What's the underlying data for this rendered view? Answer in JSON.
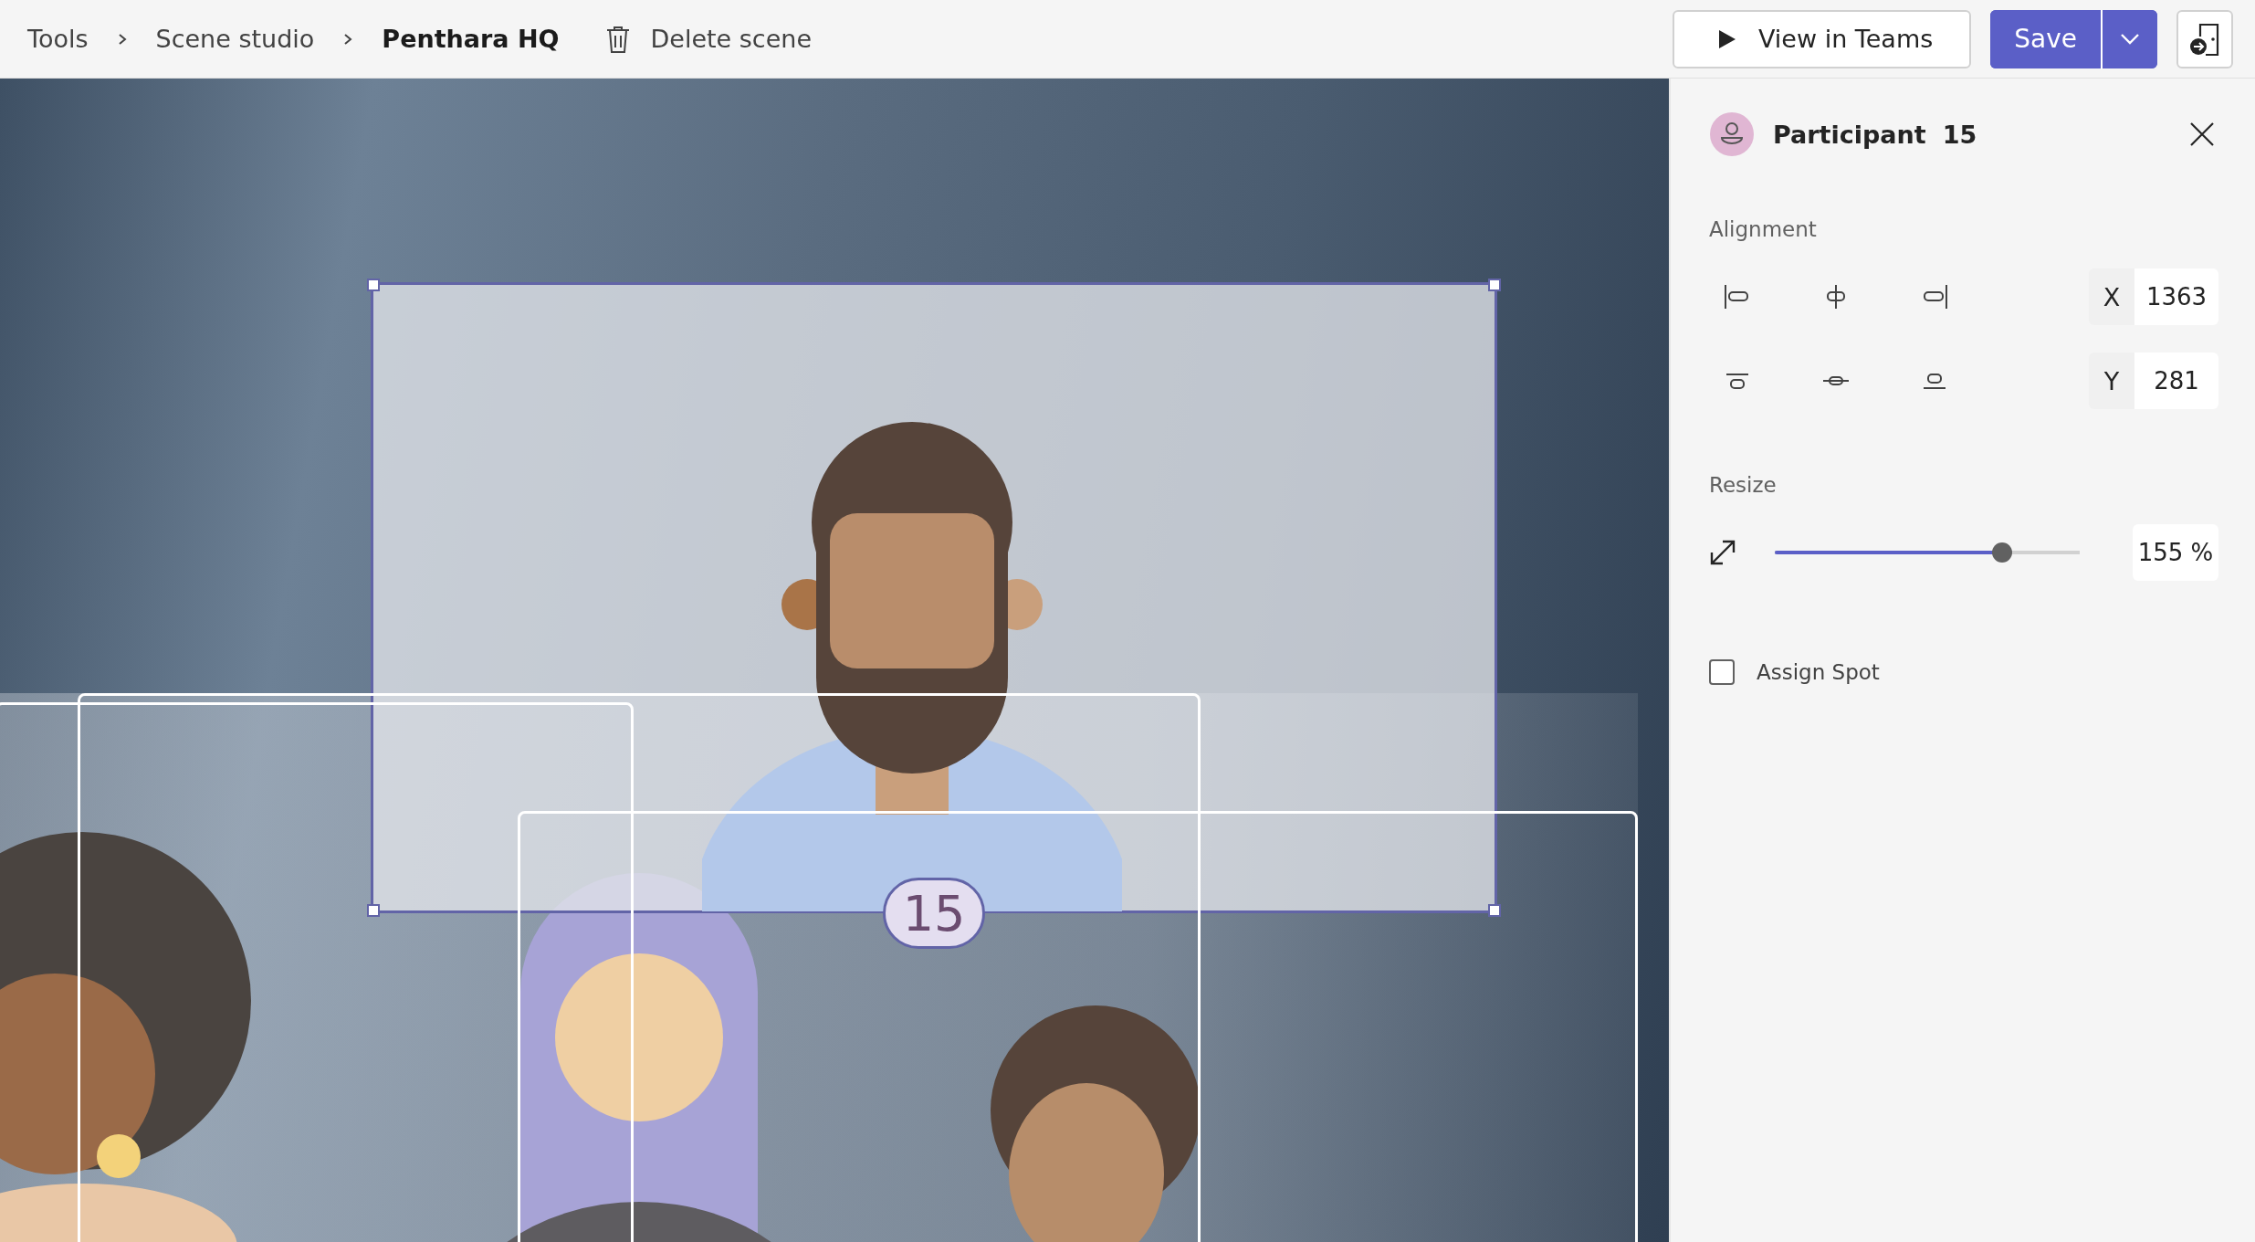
{
  "breadcrumbs": [
    {
      "label": "Tools",
      "current": false
    },
    {
      "label": "Scene studio",
      "current": false
    },
    {
      "label": "Penthara HQ",
      "current": true
    }
  ],
  "delete_action": {
    "label": "Delete scene"
  },
  "actions": {
    "view": "View in Teams",
    "save": "Save"
  },
  "canvas": {
    "selected_badge": "15"
  },
  "panel": {
    "title": "Participant",
    "number": "15",
    "alignment_label": "Alignment",
    "x_label": "X",
    "x_value": "1363",
    "y_label": "Y",
    "y_value": "281",
    "resize_label": "Resize",
    "resize": {
      "level": 0.745,
      "reading": "155 %"
    },
    "assign_spot": {
      "label": "Assign Spot",
      "checked": false
    }
  }
}
